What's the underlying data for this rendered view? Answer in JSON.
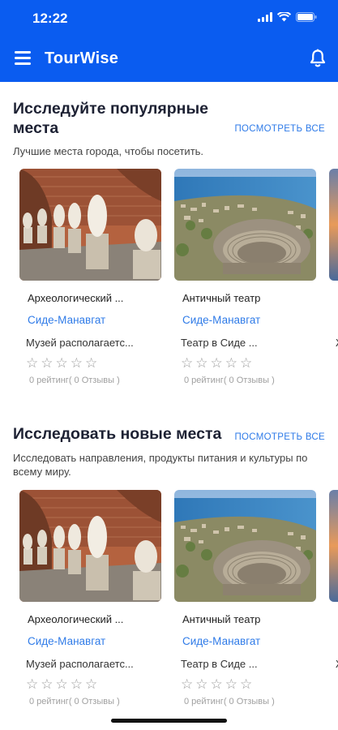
{
  "status": {
    "time": "12:22"
  },
  "header": {
    "title": "TourWise",
    "menu_icon": "menu-icon",
    "bell_icon": "bell-icon",
    "color": "#0a5cf0"
  },
  "sections": [
    {
      "title_line1": "Исследуйте популярные",
      "title_line2": "места",
      "see_all": "посмотреть все",
      "subtitle": "Лучшие места города, чтобы посетить.",
      "cards": [
        {
          "name": "Археологический  ...",
          "location": "Сиде-Манавгат",
          "desc": "Музей располагаетс...",
          "rating": "0 рейтинг( 0 Отзывы )",
          "stars": 0,
          "image": "museum-statues"
        },
        {
          "name": "Античный театр",
          "location": "Сиде-Манавгат",
          "desc": "Театр в Сиде ...",
          "rating": "0 рейтинг( 0 Отзывы )",
          "stars": 0,
          "image": "ancient-theatre"
        },
        {
          "name": "",
          "location": "",
          "desc": "Ж",
          "rating": "",
          "stars": 0,
          "image": "sunset"
        }
      ]
    },
    {
      "title_line1": "Исследовать новые места",
      "title_line2": "",
      "see_all": "посмотреть все",
      "subtitle": "Исследовать направления, продукты питания и культуры по всему миру.",
      "cards": [
        {
          "name": "Археологический  ...",
          "location": "Сиде-Манавгат",
          "desc": "Музей располагаетс...",
          "rating": "0 рейтинг( 0 Отзывы )",
          "stars": 0,
          "image": "museum-statues"
        },
        {
          "name": "Античный театр",
          "location": "Сиде-Манавгат",
          "desc": "Театр в Сиде ...",
          "rating": "0 рейтинг( 0 Отзывы )",
          "stars": 0,
          "image": "ancient-theatre"
        },
        {
          "name": "",
          "location": "",
          "desc": "Ж",
          "rating": "",
          "stars": 0,
          "image": "sunset"
        }
      ]
    }
  ],
  "colors": {
    "accent": "#0a5cf0",
    "link": "#2f7be8",
    "star": "#9a9a9a"
  }
}
